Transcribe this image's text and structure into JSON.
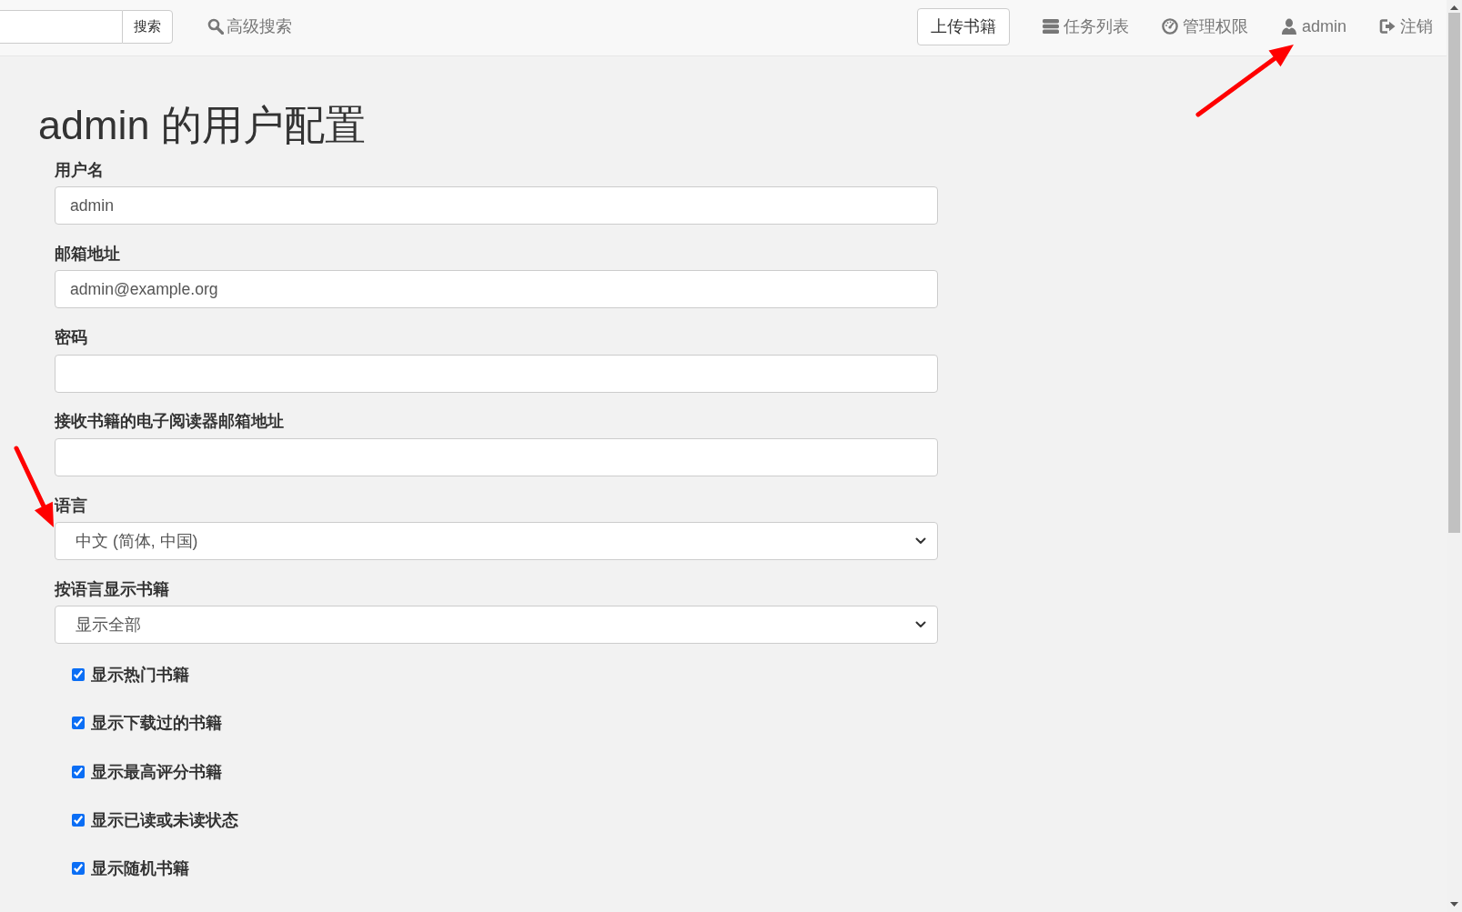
{
  "navbar": {
    "search_button": "搜索",
    "advanced_search": "高级搜索",
    "upload_button": "上传书籍",
    "links": [
      {
        "kind": "tasks",
        "label": "任务列表"
      },
      {
        "kind": "admin",
        "label": "管理权限"
      },
      {
        "kind": "user",
        "label": "admin"
      },
      {
        "kind": "logout",
        "label": "注销"
      }
    ]
  },
  "title": "admin 的用户配置",
  "fields": [
    {
      "kind": "text",
      "label": "用户名",
      "value": "admin"
    },
    {
      "kind": "text",
      "label": "邮箱地址",
      "value": "admin@example.org"
    },
    {
      "kind": "password",
      "label": "密码"
    },
    {
      "kind": "text",
      "label": "接收书籍的电子阅读器邮箱地址"
    },
    {
      "kind": "select",
      "label": "语言",
      "value": "中文 (简体, 中国)"
    },
    {
      "kind": "select",
      "label": "按语言显示书籍",
      "value": "显示全部"
    }
  ],
  "checkboxes": [
    {
      "label": "显示热门书籍",
      "checked": true
    },
    {
      "label": "显示下载过的书籍",
      "checked": true
    },
    {
      "label": "显示最高评分书籍",
      "checked": true
    },
    {
      "label": "显示已读或未读状态",
      "checked": true
    },
    {
      "label": "显示随机书籍",
      "checked": true
    }
  ]
}
